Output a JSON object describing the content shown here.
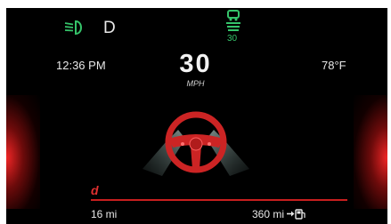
{
  "status_bar": {
    "gear": "D",
    "acc_set_speed": "30",
    "icons": {
      "headlight": "low-beam-headlight-icon",
      "adaptive_cruise": "adaptive-cruise-icon",
      "fuel": "fuel-pump-icon"
    }
  },
  "info": {
    "time": "12:36 PM",
    "speed": "30",
    "speed_units": "MPH",
    "outside_temp": "78°F"
  },
  "drive": {
    "mode": "d"
  },
  "trip": {
    "distance": "16 mi",
    "range": "360 mi"
  },
  "colors": {
    "indicator_green": "#35c46a",
    "accent_red": "#e03030",
    "text": "#e8e8e8",
    "background": "#000000"
  }
}
